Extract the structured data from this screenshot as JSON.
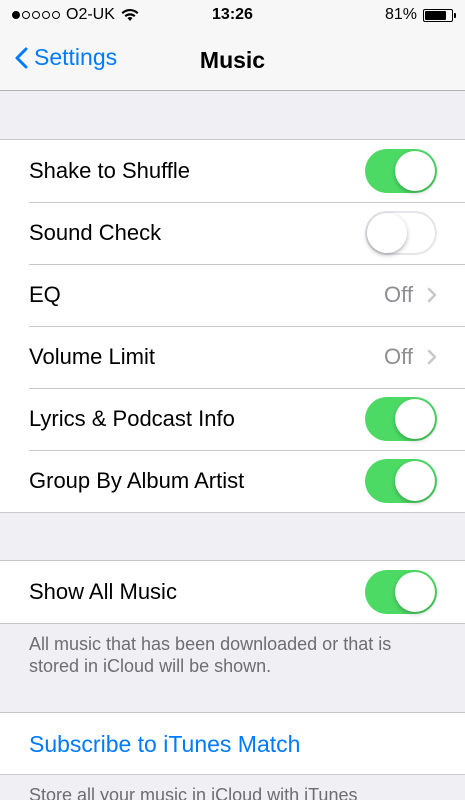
{
  "status_bar": {
    "carrier": "O2-UK",
    "time": "13:26",
    "battery": "81%",
    "battery_level": 0.81,
    "signal_bars": 1,
    "signal_total": 5,
    "wifi_icon": "wifi-icon"
  },
  "nav": {
    "back_label": "Settings",
    "title": "Music"
  },
  "group1": {
    "shake_to_shuffle": {
      "label": "Shake to Shuffle",
      "on": true
    },
    "sound_check": {
      "label": "Sound Check",
      "on": false
    },
    "eq": {
      "label": "EQ",
      "value": "Off"
    },
    "volume_limit": {
      "label": "Volume Limit",
      "value": "Off"
    },
    "lyrics": {
      "label": "Lyrics & Podcast Info",
      "on": true
    },
    "group_by_album_artist": {
      "label": "Group By Album Artist",
      "on": true
    }
  },
  "group2": {
    "show_all_music": {
      "label": "Show All Music",
      "on": true
    },
    "footer": "All music that has been downloaded or that is stored in iCloud will be shown."
  },
  "group3": {
    "subscribe_label": "Subscribe to iTunes Match",
    "footer": "Store all your music in iCloud with iTunes"
  },
  "colors": {
    "accent": "#007aff",
    "toggle_on": "#4cd964",
    "background": "#efeff4"
  }
}
